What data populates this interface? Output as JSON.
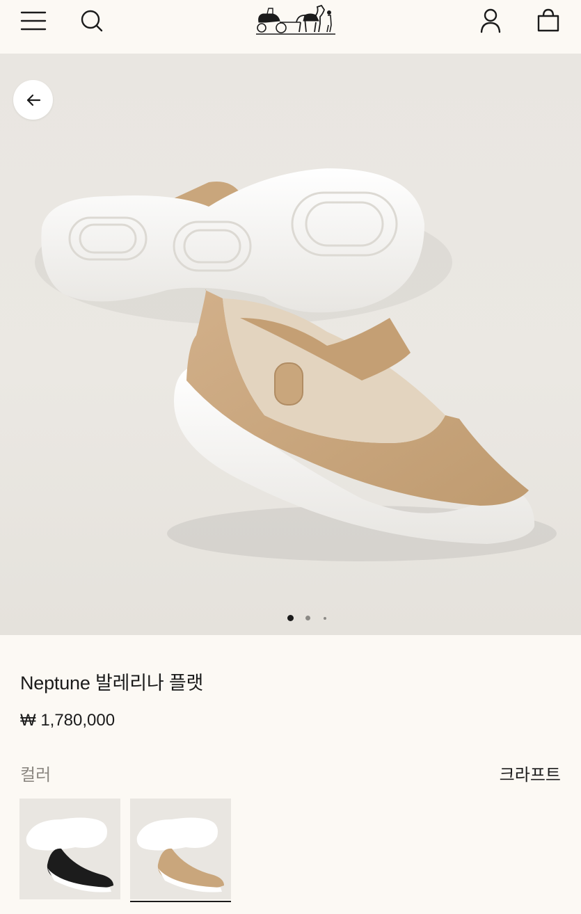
{
  "header": {
    "menu_icon": "menu-icon",
    "search_icon": "search-icon",
    "logo": "hermes-carriage-logo",
    "account_icon": "user-icon",
    "bag_icon": "shopping-bag-icon"
  },
  "gallery": {
    "back_icon": "arrow-left-icon",
    "slide_count": 3,
    "active_slide": 1
  },
  "product": {
    "title": "Neptune 발레리나 플랫",
    "price": "₩ 1,780,000",
    "color_label": "컬러",
    "color_value": "크라프트",
    "swatches": [
      {
        "name": "black",
        "color": "#1c1c1c",
        "selected": false
      },
      {
        "name": "kraft",
        "color": "#c9a67c",
        "selected": true
      }
    ]
  },
  "colors": {
    "background": "#fcf9f4",
    "text": "#1b1b1b",
    "muted": "#8b8781",
    "suede": "#c9a67c"
  }
}
